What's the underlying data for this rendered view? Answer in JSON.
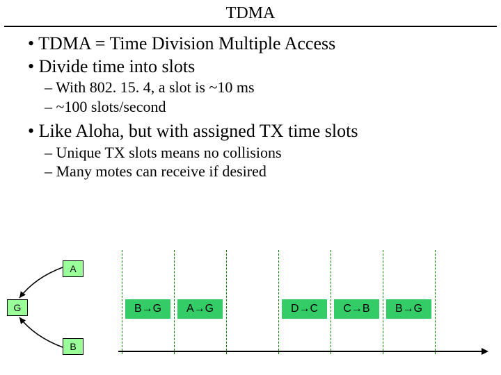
{
  "title": "TDMA",
  "bullets": {
    "b1": "TDMA = Time Division Multiple Access",
    "b2": "Divide time into slots",
    "b2_sub1": "With 802. 15. 4, a slot is ~10 ms",
    "b2_sub2": "~100 slots/second",
    "b3": "Like Aloha, but with assigned TX time slots",
    "b3_sub1": "Unique TX slots means no collisions",
    "b3_sub2": "Many motes can receive if desired"
  },
  "nodes": {
    "a": "A",
    "g": "G",
    "b": "B"
  },
  "slots": {
    "s1": "B→G",
    "s2": "A→G",
    "s3": "D→C",
    "s4": "C→B",
    "s5": "B→G"
  }
}
